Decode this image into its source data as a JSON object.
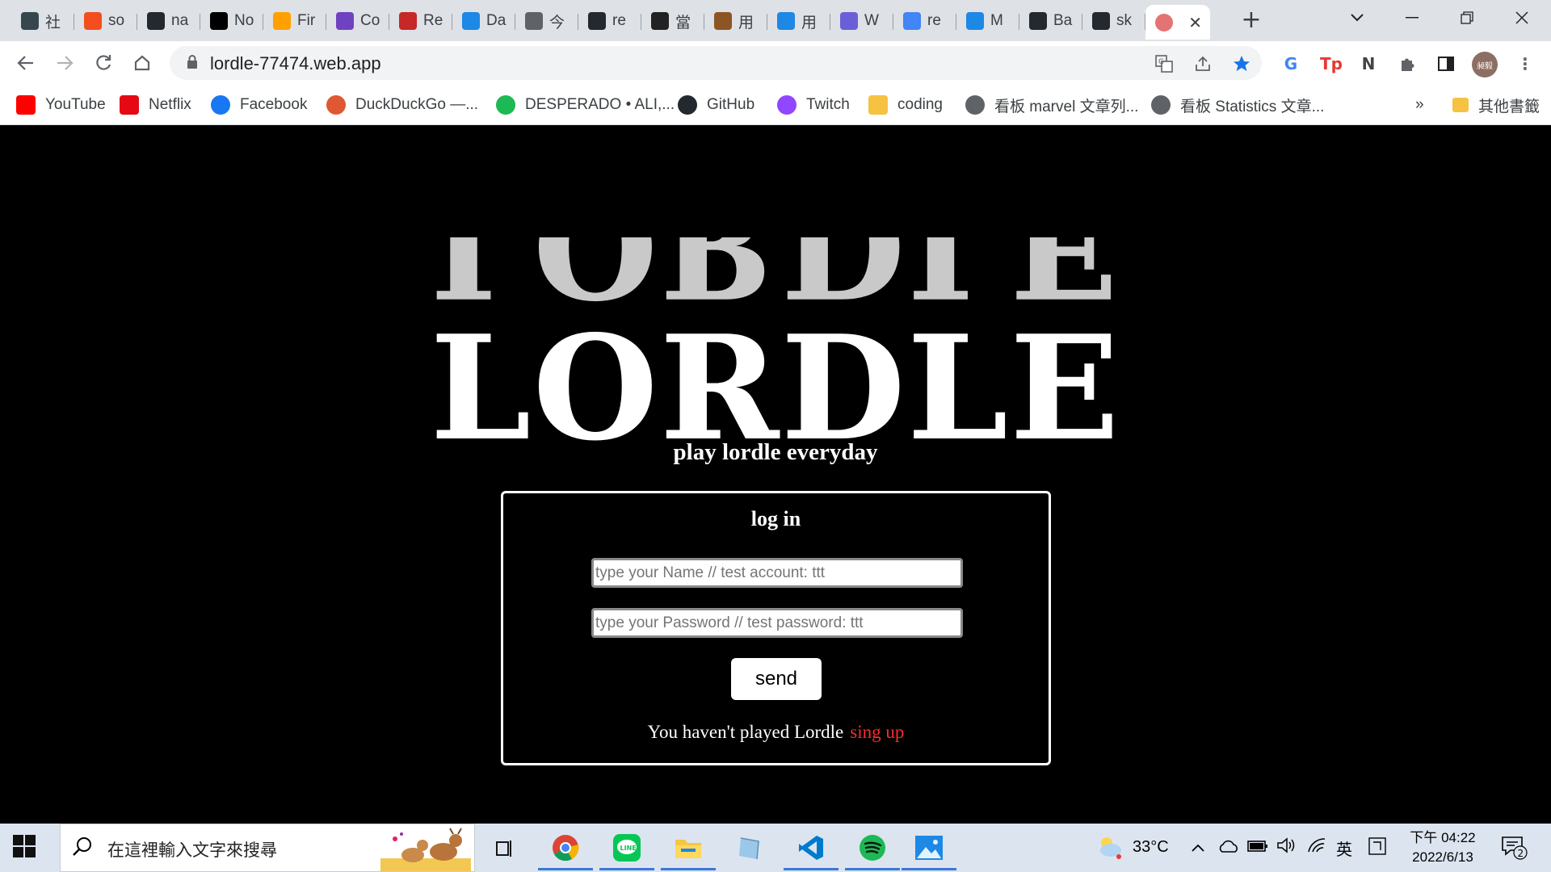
{
  "browser": {
    "tabs": [
      {
        "title": "社",
        "icon": "feather-icon",
        "color": "#37474f"
      },
      {
        "title": "so",
        "icon": "figma-icon",
        "color": "#f24e1e"
      },
      {
        "title": "na",
        "icon": "github-icon",
        "color": "#24292f"
      },
      {
        "title": "No",
        "icon": "notion-icon",
        "color": "#000000"
      },
      {
        "title": "Fir",
        "icon": "firebase-icon",
        "color": "#ffa000"
      },
      {
        "title": "Co",
        "icon": "codeacademy-icon",
        "color": "#6f42c1"
      },
      {
        "title": "Re",
        "icon": "react-dots-icon",
        "color": "#c62828"
      },
      {
        "title": "Da",
        "icon": "web-icon",
        "color": "#1e88e5"
      },
      {
        "title": "今",
        "icon": "globe-icon",
        "color": "#5f6368"
      },
      {
        "title": "re",
        "icon": "github-icon",
        "color": "#24292f"
      },
      {
        "title": "當",
        "icon": "tb-icon",
        "color": "#222222"
      },
      {
        "title": "用",
        "icon": "picture-icon",
        "color": "#8d5524"
      },
      {
        "title": "用",
        "icon": "web-icon",
        "color": "#1e88e5"
      },
      {
        "title": "W",
        "icon": "openai-icon",
        "color": "#6b5fd8"
      },
      {
        "title": "re",
        "icon": "google-icon",
        "color": "#4285f4"
      },
      {
        "title": "M",
        "icon": "web-icon",
        "color": "#1e88e5"
      },
      {
        "title": "Ba",
        "icon": "github-icon",
        "color": "#24292f"
      },
      {
        "title": "sk",
        "icon": "github-icon",
        "color": "#24292f"
      }
    ],
    "active_tab": {
      "icon": "brain-icon",
      "color": "#e57373"
    },
    "url": "lordle-77474.web.app",
    "bookmarks": [
      {
        "label": "YouTube",
        "icon": "youtube-icon",
        "color": "#ff0000"
      },
      {
        "label": "Netflix",
        "icon": "netflix-icon",
        "color": "#e50914"
      },
      {
        "label": "Facebook",
        "icon": "facebook-icon",
        "color": "#1877f2"
      },
      {
        "label": "DuckDuckGo —...",
        "icon": "duckduckgo-icon",
        "color": "#de5833"
      },
      {
        "label": "DESPERADO • ALI,...",
        "icon": "spotify-icon",
        "color": "#1db954"
      },
      {
        "label": "GitHub",
        "icon": "github-icon",
        "color": "#24292f"
      },
      {
        "label": "Twitch",
        "icon": "twitch-icon",
        "color": "#9146ff"
      },
      {
        "label": "coding",
        "icon": "folder-icon",
        "color": "#f5c242"
      },
      {
        "label": "看板 marvel 文章列...",
        "icon": "globe-icon",
        "color": "#5f6368"
      },
      {
        "label": "看板 Statistics 文章...",
        "icon": "globe-icon",
        "color": "#5f6368"
      }
    ],
    "bookmarks_overflow": "»",
    "other_bookmarks": "其他書籤",
    "avatar_text": "昶毅"
  },
  "page": {
    "logo": "LORDLE",
    "tagline": "play lordle everyday",
    "login": {
      "title": "log in",
      "name_placeholder": "type your Name // test account: ttt",
      "password_placeholder": "type your Password // test password: ttt",
      "send_label": "send",
      "no_account_text": "You haven't played Lordle",
      "signup_label": "sing up"
    }
  },
  "taskbar": {
    "search_placeholder": "在這裡輸入文字來搜尋",
    "weather": "33°C",
    "ime": "英",
    "time": "下午 04:22",
    "date": "2022/6/13",
    "notifications": "2"
  }
}
